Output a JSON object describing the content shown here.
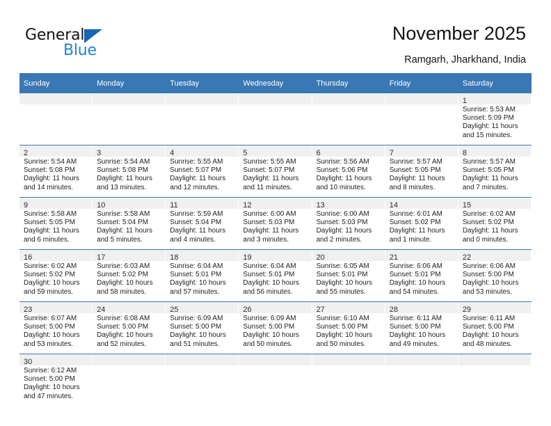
{
  "brand": {
    "name_part1": "General",
    "name_part2": "Blue",
    "color_dark": "#141414",
    "color_blue": "#1f83d2",
    "triangle_color": "#1668b3"
  },
  "header": {
    "title": "November 2025",
    "subtitle": "Ramgarh, Jharkhand, India",
    "header_bg": "#3a77b5",
    "header_text_color": "#ffffff",
    "daynum_band_bg": "#f0f0f0"
  },
  "weekday_headers": [
    "Sunday",
    "Monday",
    "Tuesday",
    "Wednesday",
    "Thursday",
    "Friday",
    "Saturday"
  ],
  "weeks": [
    [
      {
        "day": "",
        "l1": "",
        "l2": "",
        "l3": "",
        "l4": ""
      },
      {
        "day": "",
        "l1": "",
        "l2": "",
        "l3": "",
        "l4": ""
      },
      {
        "day": "",
        "l1": "",
        "l2": "",
        "l3": "",
        "l4": ""
      },
      {
        "day": "",
        "l1": "",
        "l2": "",
        "l3": "",
        "l4": ""
      },
      {
        "day": "",
        "l1": "",
        "l2": "",
        "l3": "",
        "l4": ""
      },
      {
        "day": "",
        "l1": "",
        "l2": "",
        "l3": "",
        "l4": ""
      },
      {
        "day": "1",
        "l1": "Sunrise: 5:53 AM",
        "l2": "Sunset: 5:09 PM",
        "l3": "Daylight: 11 hours",
        "l4": "and 15 minutes."
      }
    ],
    [
      {
        "day": "2",
        "l1": "Sunrise: 5:54 AM",
        "l2": "Sunset: 5:08 PM",
        "l3": "Daylight: 11 hours",
        "l4": "and 14 minutes."
      },
      {
        "day": "3",
        "l1": "Sunrise: 5:54 AM",
        "l2": "Sunset: 5:08 PM",
        "l3": "Daylight: 11 hours",
        "l4": "and 13 minutes."
      },
      {
        "day": "4",
        "l1": "Sunrise: 5:55 AM",
        "l2": "Sunset: 5:07 PM",
        "l3": "Daylight: 11 hours",
        "l4": "and 12 minutes."
      },
      {
        "day": "5",
        "l1": "Sunrise: 5:55 AM",
        "l2": "Sunset: 5:07 PM",
        "l3": "Daylight: 11 hours",
        "l4": "and 11 minutes."
      },
      {
        "day": "6",
        "l1": "Sunrise: 5:56 AM",
        "l2": "Sunset: 5:06 PM",
        "l3": "Daylight: 11 hours",
        "l4": "and 10 minutes."
      },
      {
        "day": "7",
        "l1": "Sunrise: 5:57 AM",
        "l2": "Sunset: 5:05 PM",
        "l3": "Daylight: 11 hours",
        "l4": "and 8 minutes."
      },
      {
        "day": "8",
        "l1": "Sunrise: 5:57 AM",
        "l2": "Sunset: 5:05 PM",
        "l3": "Daylight: 11 hours",
        "l4": "and 7 minutes."
      }
    ],
    [
      {
        "day": "9",
        "l1": "Sunrise: 5:58 AM",
        "l2": "Sunset: 5:05 PM",
        "l3": "Daylight: 11 hours",
        "l4": "and 6 minutes."
      },
      {
        "day": "10",
        "l1": "Sunrise: 5:58 AM",
        "l2": "Sunset: 5:04 PM",
        "l3": "Daylight: 11 hours",
        "l4": "and 5 minutes."
      },
      {
        "day": "11",
        "l1": "Sunrise: 5:59 AM",
        "l2": "Sunset: 5:04 PM",
        "l3": "Daylight: 11 hours",
        "l4": "and 4 minutes."
      },
      {
        "day": "12",
        "l1": "Sunrise: 6:00 AM",
        "l2": "Sunset: 5:03 PM",
        "l3": "Daylight: 11 hours",
        "l4": "and 3 minutes."
      },
      {
        "day": "13",
        "l1": "Sunrise: 6:00 AM",
        "l2": "Sunset: 5:03 PM",
        "l3": "Daylight: 11 hours",
        "l4": "and 2 minutes."
      },
      {
        "day": "14",
        "l1": "Sunrise: 6:01 AM",
        "l2": "Sunset: 5:02 PM",
        "l3": "Daylight: 11 hours",
        "l4": "and 1 minute."
      },
      {
        "day": "15",
        "l1": "Sunrise: 6:02 AM",
        "l2": "Sunset: 5:02 PM",
        "l3": "Daylight: 11 hours",
        "l4": "and 0 minutes."
      }
    ],
    [
      {
        "day": "16",
        "l1": "Sunrise: 6:02 AM",
        "l2": "Sunset: 5:02 PM",
        "l3": "Daylight: 10 hours",
        "l4": "and 59 minutes."
      },
      {
        "day": "17",
        "l1": "Sunrise: 6:03 AM",
        "l2": "Sunset: 5:02 PM",
        "l3": "Daylight: 10 hours",
        "l4": "and 58 minutes."
      },
      {
        "day": "18",
        "l1": "Sunrise: 6:04 AM",
        "l2": "Sunset: 5:01 PM",
        "l3": "Daylight: 10 hours",
        "l4": "and 57 minutes."
      },
      {
        "day": "19",
        "l1": "Sunrise: 6:04 AM",
        "l2": "Sunset: 5:01 PM",
        "l3": "Daylight: 10 hours",
        "l4": "and 56 minutes."
      },
      {
        "day": "20",
        "l1": "Sunrise: 6:05 AM",
        "l2": "Sunset: 5:01 PM",
        "l3": "Daylight: 10 hours",
        "l4": "and 55 minutes."
      },
      {
        "day": "21",
        "l1": "Sunrise: 6:06 AM",
        "l2": "Sunset: 5:01 PM",
        "l3": "Daylight: 10 hours",
        "l4": "and 54 minutes."
      },
      {
        "day": "22",
        "l1": "Sunrise: 6:06 AM",
        "l2": "Sunset: 5:00 PM",
        "l3": "Daylight: 10 hours",
        "l4": "and 53 minutes."
      }
    ],
    [
      {
        "day": "23",
        "l1": "Sunrise: 6:07 AM",
        "l2": "Sunset: 5:00 PM",
        "l3": "Daylight: 10 hours",
        "l4": "and 53 minutes."
      },
      {
        "day": "24",
        "l1": "Sunrise: 6:08 AM",
        "l2": "Sunset: 5:00 PM",
        "l3": "Daylight: 10 hours",
        "l4": "and 52 minutes."
      },
      {
        "day": "25",
        "l1": "Sunrise: 6:09 AM",
        "l2": "Sunset: 5:00 PM",
        "l3": "Daylight: 10 hours",
        "l4": "and 51 minutes."
      },
      {
        "day": "26",
        "l1": "Sunrise: 6:09 AM",
        "l2": "Sunset: 5:00 PM",
        "l3": "Daylight: 10 hours",
        "l4": "and 50 minutes."
      },
      {
        "day": "27",
        "l1": "Sunrise: 6:10 AM",
        "l2": "Sunset: 5:00 PM",
        "l3": "Daylight: 10 hours",
        "l4": "and 50 minutes."
      },
      {
        "day": "28",
        "l1": "Sunrise: 6:11 AM",
        "l2": "Sunset: 5:00 PM",
        "l3": "Daylight: 10 hours",
        "l4": "and 49 minutes."
      },
      {
        "day": "29",
        "l1": "Sunrise: 6:11 AM",
        "l2": "Sunset: 5:00 PM",
        "l3": "Daylight: 10 hours",
        "l4": "and 48 minutes."
      }
    ],
    [
      {
        "day": "30",
        "l1": "Sunrise: 6:12 AM",
        "l2": "Sunset: 5:00 PM",
        "l3": "Daylight: 10 hours",
        "l4": "and 47 minutes."
      },
      {
        "day": "",
        "l1": "",
        "l2": "",
        "l3": "",
        "l4": ""
      },
      {
        "day": "",
        "l1": "",
        "l2": "",
        "l3": "",
        "l4": ""
      },
      {
        "day": "",
        "l1": "",
        "l2": "",
        "l3": "",
        "l4": ""
      },
      {
        "day": "",
        "l1": "",
        "l2": "",
        "l3": "",
        "l4": ""
      },
      {
        "day": "",
        "l1": "",
        "l2": "",
        "l3": "",
        "l4": ""
      },
      {
        "day": "",
        "l1": "",
        "l2": "",
        "l3": "",
        "l4": ""
      }
    ]
  ]
}
